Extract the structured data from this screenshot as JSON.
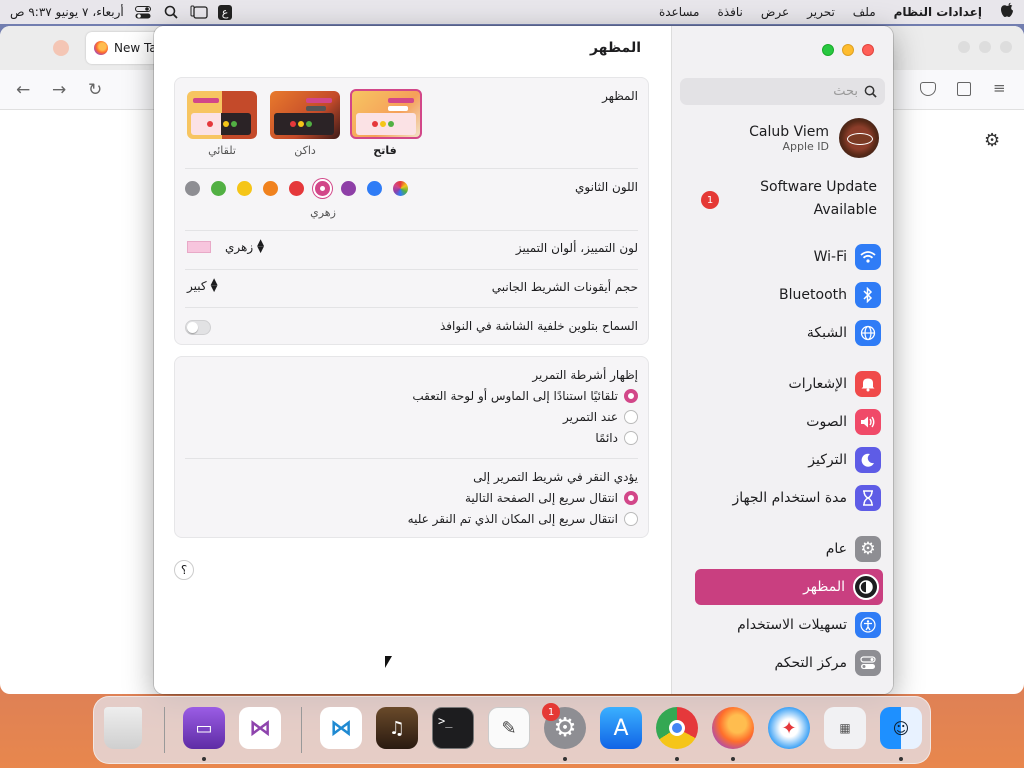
{
  "menubar": {
    "clock": "أربعاء، ٧ يونيو ٩:٣٧ ص",
    "input_source": "ع",
    "app_name": "إعدادات النظام",
    "menus": [
      "ملف",
      "تحرير",
      "عرض",
      "نافذة",
      "مساعدة"
    ]
  },
  "browser": {
    "tab_title": "New Ta"
  },
  "sidebar": {
    "search_placeholder": "بحث",
    "profile_name": "Calub Viem",
    "profile_sub": "Apple ID",
    "software_update_line1": "Software Update",
    "software_update_line2": "Available",
    "software_update_badge": "1",
    "items": [
      {
        "label": "Wi-Fi",
        "icon": "wifi-icon",
        "color": "#2f7cf6"
      },
      {
        "label": "Bluetooth",
        "icon": "bluetooth-icon",
        "color": "#2f7cf6"
      },
      {
        "label": "الشبكة",
        "icon": "globe-icon",
        "color": "#2f7cf6"
      },
      {
        "label": "الإشعارات",
        "icon": "bell-icon",
        "color": "#f04a4a"
      },
      {
        "label": "الصوت",
        "icon": "speaker-icon",
        "color": "#f04a68"
      },
      {
        "label": "التركيز",
        "icon": "moon-icon",
        "color": "#5e5ce6"
      },
      {
        "label": "مدة استخدام الجهاز",
        "icon": "hourglass-icon",
        "color": "#5e5ce6"
      },
      {
        "label": "عام",
        "icon": "gear-icon",
        "color": "#8e8e93"
      },
      {
        "label": "المظهر",
        "icon": "appearance-icon",
        "color": "#1d1d1f"
      },
      {
        "label": "تسهيلات الاستخدام",
        "icon": "accessibility-icon",
        "color": "#2f7cf6"
      },
      {
        "label": "مركز التحكم",
        "icon": "control-center-icon",
        "color": "#8e8e93"
      }
    ],
    "active_item": "المظهر"
  },
  "main": {
    "title": "المظهر",
    "appearance": {
      "label": "المظهر",
      "options": [
        {
          "label": "فاتح",
          "selected": true
        },
        {
          "label": "داكن",
          "selected": false
        },
        {
          "label": "تلقائي",
          "selected": false
        }
      ]
    },
    "accent": {
      "label": "اللون الثانوي",
      "selected_name": "زهري",
      "colors": [
        "#8e8e93",
        "#52b043",
        "#f5c518",
        "#f0821e",
        "#e5383b",
        "#d24789",
        "#8e3fa7",
        "#2f7cf6",
        "multicolor"
      ]
    },
    "highlight": {
      "label": "لون التمييز، ألوان التمييز",
      "value": "زهري",
      "swatch": "#f7c5dd"
    },
    "sidebar_icon_size": {
      "label": "حجم أيقونات الشريط الجانبي",
      "value": "كبير"
    },
    "wallpaper_tinting": {
      "label": "السماح بتلوين خلفية الشاشة في النوافذ",
      "enabled": false
    },
    "scrollbars": {
      "label": "إظهار أشرطة التمرير",
      "options": [
        {
          "label": "تلقائيًا استنادًا إلى الماوس أو لوحة التعقب",
          "selected": true
        },
        {
          "label": "عند التمرير",
          "selected": false
        },
        {
          "label": "دائمًا",
          "selected": false
        }
      ]
    },
    "click_scrollbar": {
      "label": "يؤدي النقر في شريط التمرير إلى",
      "options": [
        {
          "label": "انتقال سريع إلى الصفحة التالية",
          "selected": true
        },
        {
          "label": "انتقال سريع إلى المكان الذي تم النقر عليه",
          "selected": false
        }
      ]
    },
    "help": "؟"
  },
  "dock": {
    "apps": [
      "Trash",
      "Apple Configurator",
      "Visual Studio",
      "Visual Studio Code",
      "GarageBand",
      "Terminal",
      "TextEdit",
      "System Settings",
      "App Store",
      "Chrome",
      "Firefox",
      "Safari",
      "Launchpad",
      "Finder"
    ],
    "settings_badge": "1"
  }
}
